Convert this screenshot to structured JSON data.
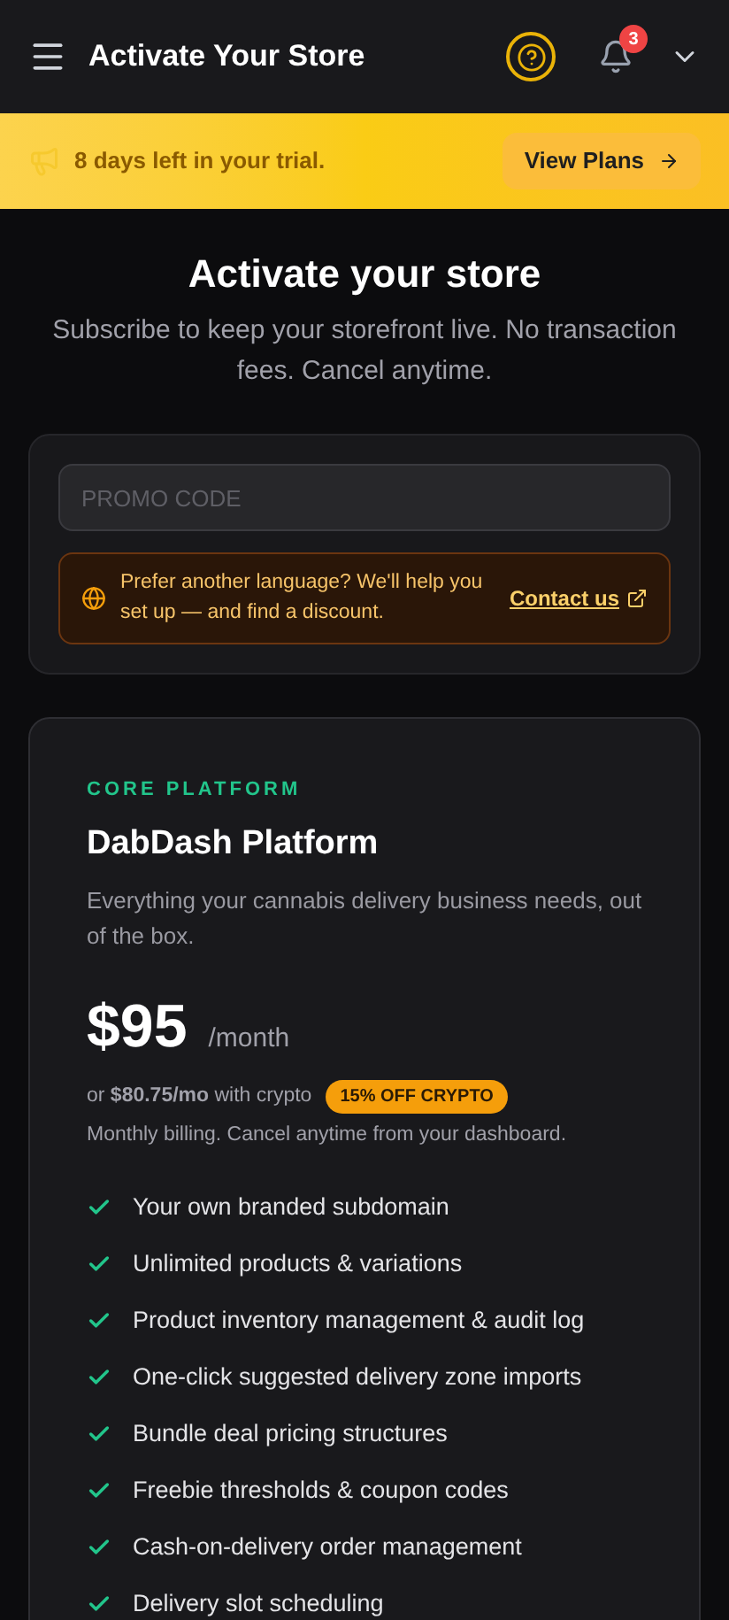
{
  "header": {
    "title": "Activate Your Store",
    "notification_count": "3"
  },
  "trial_banner": {
    "text": "8 days left in your trial.",
    "button": "View Plans"
  },
  "intro": {
    "title": "Activate your store",
    "subtitle": "Subscribe to keep your storefront live. No transaction fees. Cancel anytime."
  },
  "promo": {
    "placeholder": "PROMO CODE"
  },
  "language_notice": {
    "text": "Prefer another language? We'll help you set up — and find a discount.",
    "link": "Contact us"
  },
  "plan": {
    "eyebrow": "CORE PLATFORM",
    "name": "DabDash Platform",
    "description": "Everything your cannabis delivery business needs, out of the box.",
    "price": "$95",
    "period": "/month",
    "crypto_note": "or **$80.75/mo** with crypto",
    "crypto_badge": "15% OFF CRYPTO",
    "billing_note": "Monthly billing. Cancel anytime from your dashboard.",
    "features": [
      "Your own branded subdomain",
      "Unlimited products & variations",
      "Product inventory management & audit log",
      "One-click suggested delivery zone imports",
      "Bundle deal pricing structures",
      "Freebie thresholds & coupon codes",
      "Cash-on-delivery order management",
      "Delivery slot scheduling"
    ]
  }
}
